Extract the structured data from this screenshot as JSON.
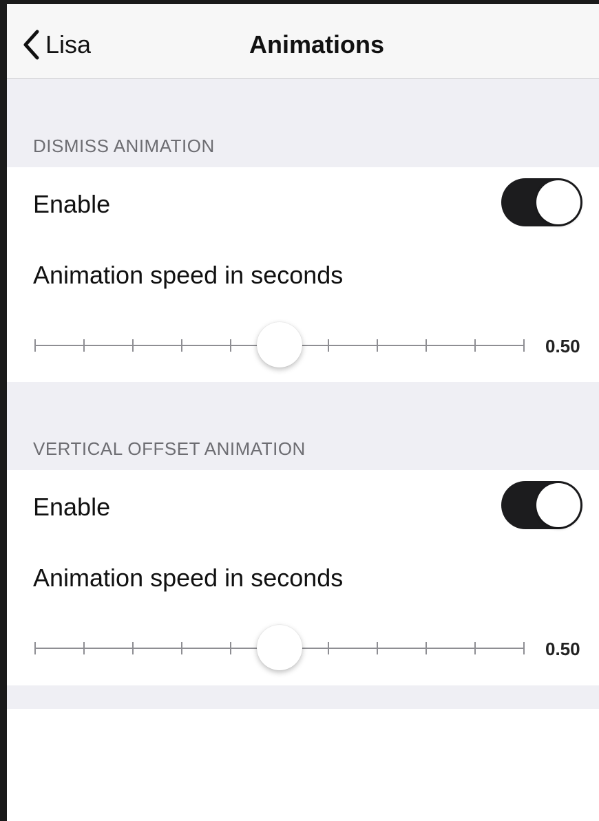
{
  "navbar": {
    "back_label": "Lisa",
    "title": "Animations"
  },
  "sections": [
    {
      "header": "DISMISS ANIMATION",
      "enable_label": "Enable",
      "enabled": true,
      "speed_label": "Animation speed in seconds",
      "speed_value": "0.50",
      "slider_fraction": 0.5
    },
    {
      "header": "VERTICAL OFFSET ANIMATION",
      "enable_label": "Enable",
      "enabled": true,
      "speed_label": "Animation speed in seconds",
      "speed_value": "0.50",
      "slider_fraction": 0.5
    }
  ],
  "colors": {
    "toggle_on": "#1c1c1e",
    "group_background": "#efeff4",
    "section_header_text": "#6d6d72"
  }
}
